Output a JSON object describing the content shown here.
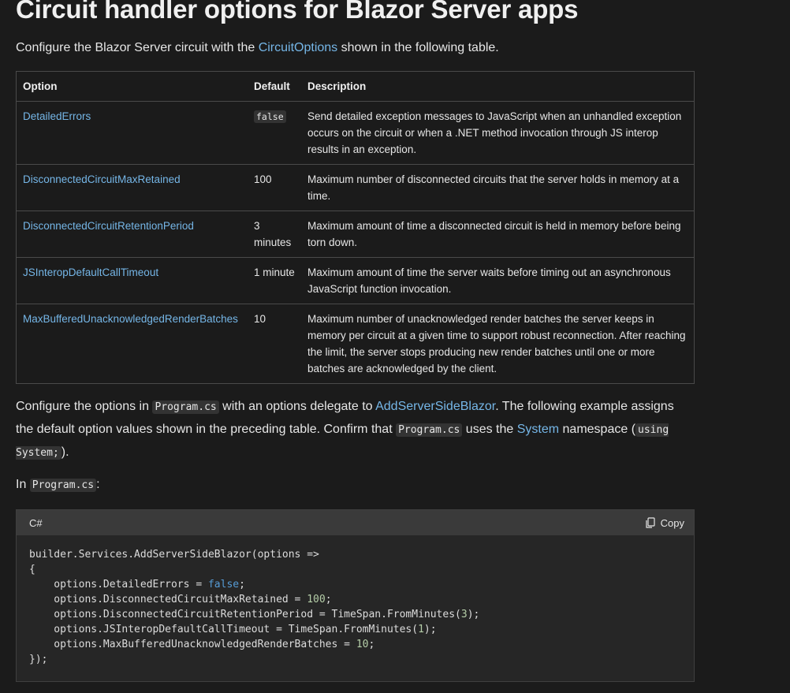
{
  "heading": "Circuit handler options for Blazor Server apps",
  "intro": {
    "before": "Configure the Blazor Server circuit with the ",
    "link": "CircuitOptions",
    "after": " shown in the following table."
  },
  "table": {
    "headers": [
      "Option",
      "Default",
      "Description"
    ],
    "rows": [
      {
        "option": "DetailedErrors",
        "default": "false",
        "default_is_code": true,
        "description": "Send detailed exception messages to JavaScript when an unhandled exception occurs on the circuit or when a .NET method invocation through JS interop results in an exception."
      },
      {
        "option": "DisconnectedCircuitMaxRetained",
        "default": "100",
        "default_is_code": false,
        "description": "Maximum number of disconnected circuits that the server holds in memory at a time."
      },
      {
        "option": "DisconnectedCircuitRetentionPeriod",
        "default": "3 minutes",
        "default_is_code": false,
        "description": "Maximum amount of time a disconnected circuit is held in memory before being torn down."
      },
      {
        "option": "JSInteropDefaultCallTimeout",
        "default": "1 minute",
        "default_is_code": false,
        "description": "Maximum amount of time the server waits before timing out an asynchronous JavaScript function invocation."
      },
      {
        "option": "MaxBufferedUnacknowledgedRenderBatches",
        "default": "10",
        "default_is_code": false,
        "description": "Maximum number of unacknowledged render batches the server keeps in memory per circuit at a given time to support robust reconnection. After reaching the limit, the server stops producing new render batches until one or more batches are acknowledged by the client."
      }
    ]
  },
  "para1": {
    "t1": "Configure the options in ",
    "code1": "Program.cs",
    "t2": " with an options delegate to ",
    "link1": "AddServerSideBlazor",
    "t3": ". The following example assigns the default option values shown in the preceding table. Confirm that ",
    "code2": "Program.cs",
    "t4": " uses the ",
    "link2": "System",
    "t5": " namespace (",
    "code3": "using System;",
    "t6": ")."
  },
  "para2": {
    "t1": "In ",
    "code1": "Program.cs",
    "t2": ":"
  },
  "codeblock": {
    "language": "C#",
    "copy_label": "Copy",
    "copy_icon": "copy-icon",
    "lines": [
      "builder.Services.AddServerSideBlazor(options =>",
      "{",
      "    options.DetailedErrors = false;",
      "    options.DisconnectedCircuitMaxRetained = 100;",
      "    options.DisconnectedCircuitRetentionPeriod = TimeSpan.FromMinutes(3);",
      "    options.JSInteropDefaultCallTimeout = TimeSpan.FromMinutes(1);",
      "    options.MaxBufferedUnacknowledgedRenderBatches = 10;",
      "});"
    ]
  },
  "colors": {
    "background": "#1b1b1b",
    "link": "#75b6e7",
    "keyword": "#569cd6",
    "number": "#b5cea8"
  }
}
